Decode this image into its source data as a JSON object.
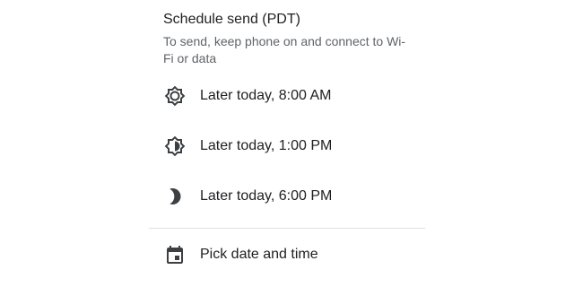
{
  "dialog": {
    "title": "Schedule send (PDT)",
    "subtitle": "To send, keep phone on and connect to Wi-Fi or data",
    "options": [
      {
        "icon": "sun-brightness-icon",
        "label": "Later today, 8:00 AM"
      },
      {
        "icon": "half-sun-brightness-icon",
        "label": "Later today, 1:00 PM"
      },
      {
        "icon": "moon-icon",
        "label": "Later today, 6:00 PM"
      }
    ],
    "custom_option": {
      "icon": "calendar-icon",
      "label": "Pick date and time"
    }
  },
  "colors": {
    "text_primary": "#202124",
    "text_secondary": "#5f6368",
    "icon": "#3c4043",
    "divider": "#e0e0e0"
  }
}
